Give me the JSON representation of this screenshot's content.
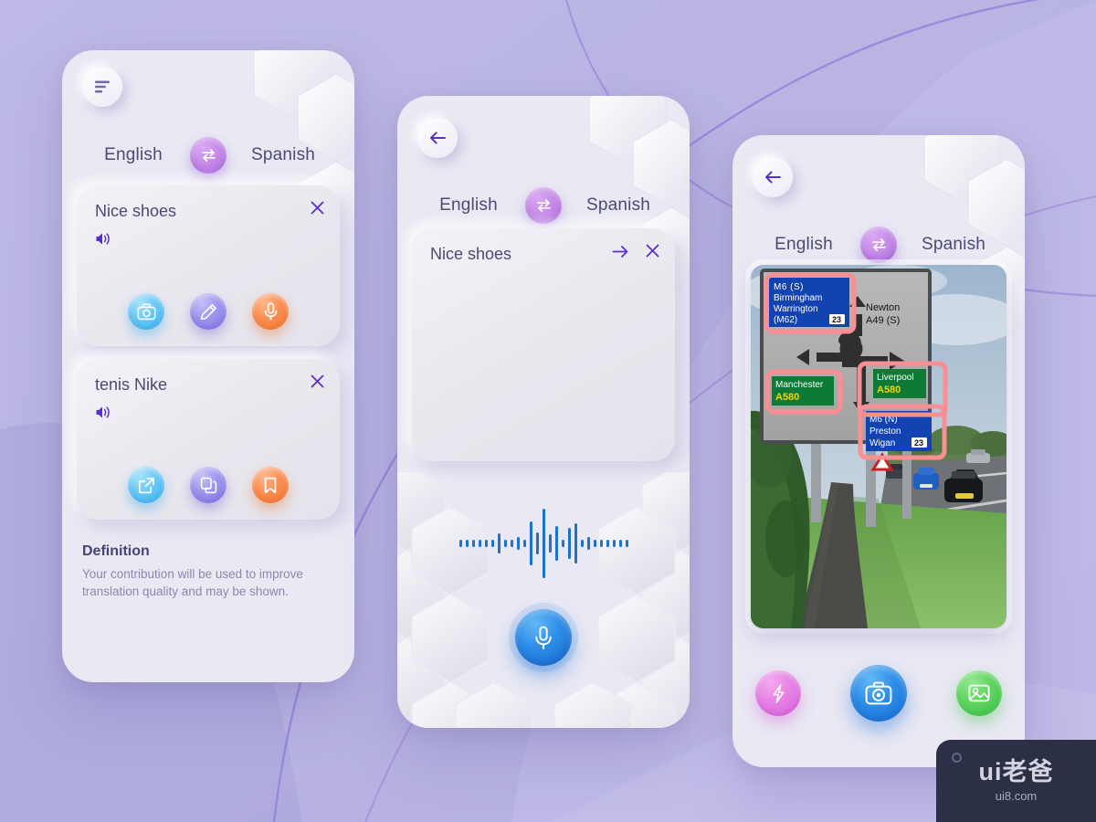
{
  "app": {
    "background_color": "#b9b5e2",
    "phone_body_color": "#e9e8f3",
    "accent_purple": "#b06fe0",
    "accent_blue": "#1468cf"
  },
  "screen1": {
    "menu_icon": "hamburger-icon",
    "languages": {
      "source": "English",
      "target": "Spanish",
      "swap_icon": "swap-arrows-icon"
    },
    "cards": [
      {
        "word": "Nice shoes",
        "close_icon": "close-icon",
        "speaker_icon": "speaker-icon",
        "actions": [
          {
            "icon": "camera-icon",
            "color": "#3bb4f2",
            "style": "blue"
          },
          {
            "icon": "pencil-icon",
            "color": "#8178e6",
            "style": "violet"
          },
          {
            "icon": "microphone-icon",
            "color": "#f4762f",
            "style": "orange"
          }
        ]
      },
      {
        "word": "tenis Nike",
        "close_icon": "close-icon",
        "speaker_icon": "speaker-icon",
        "actions": [
          {
            "icon": "share-external-icon",
            "color": "#3bb4f2",
            "style": "blue"
          },
          {
            "icon": "copy-icon",
            "color": "#8178e6",
            "style": "violet"
          },
          {
            "icon": "bookmark-icon",
            "color": "#f4762f",
            "style": "orange"
          }
        ]
      }
    ],
    "definition": {
      "title": "Definition",
      "body": "Your contribution will be used to improve translation quality and may be shown."
    }
  },
  "screen2": {
    "back_icon": "back-arrow-icon",
    "languages": {
      "source": "English",
      "target": "Spanish",
      "swap_icon": "swap-arrows-icon"
    },
    "card": {
      "word": "Nice shoes",
      "submit_icon": "arrow-right-icon",
      "close_icon": "close-icon"
    },
    "waveform": {
      "color": "#1d73c8",
      "bar_heights": [
        8,
        8,
        8,
        8,
        8,
        8,
        22,
        8,
        8,
        14,
        8,
        48,
        24,
        76,
        20,
        38,
        8,
        34,
        44,
        8,
        14,
        8,
        8,
        8,
        8,
        8,
        8
      ]
    },
    "mic_button": {
      "icon": "microphone-icon",
      "color": "#1468cf"
    }
  },
  "screen3": {
    "back_icon": "back-arrow-icon",
    "languages": {
      "source": "English",
      "target": "Spanish",
      "swap_icon": "swap-arrows-icon"
    },
    "photo": {
      "description": "roadside motorway direction sign with detected text regions highlighted",
      "highlight_color": "#f98f92",
      "sign_panels": [
        {
          "id": "m6-south",
          "lines": [
            "M6 (S)",
            "Birmingham",
            "Warrington",
            "(M62)"
          ],
          "badge": "23",
          "background": "#1343b0",
          "text_color": "#ffffff",
          "highlighted": true
        },
        {
          "id": "newton",
          "lines": [
            "Newton",
            "A49 (S)"
          ],
          "background": "#b3b3b3",
          "text_color": "#111111",
          "highlighted": false
        },
        {
          "id": "manchester",
          "lines": [
            "Manchester"
          ],
          "road": "A580",
          "background": "#0d7a35",
          "text_color": "#ffffff",
          "road_color": "#f5d400",
          "highlighted": true
        },
        {
          "id": "liverpool",
          "lines": [
            "Liverpool"
          ],
          "road": "A580",
          "background": "#0d7a35",
          "text_color": "#ffffff",
          "road_color": "#f5d400",
          "highlighted": true
        },
        {
          "id": "m6-north",
          "lines": [
            "M6 (N)",
            "Preston",
            "Wigan"
          ],
          "badge": "23",
          "background": "#1343b0",
          "text_color": "#ffffff",
          "highlighted": true
        }
      ]
    },
    "camera_bar": [
      {
        "icon": "flash-icon",
        "color": "#d964dc",
        "style": "pink"
      },
      {
        "icon": "camera-icon",
        "color": "#1673d6",
        "style": "blue"
      },
      {
        "icon": "gallery-icon",
        "color": "#3fc24a",
        "style": "green"
      }
    ]
  },
  "watermark": {
    "brand": "ui老爸",
    "url": "ui8.com"
  }
}
